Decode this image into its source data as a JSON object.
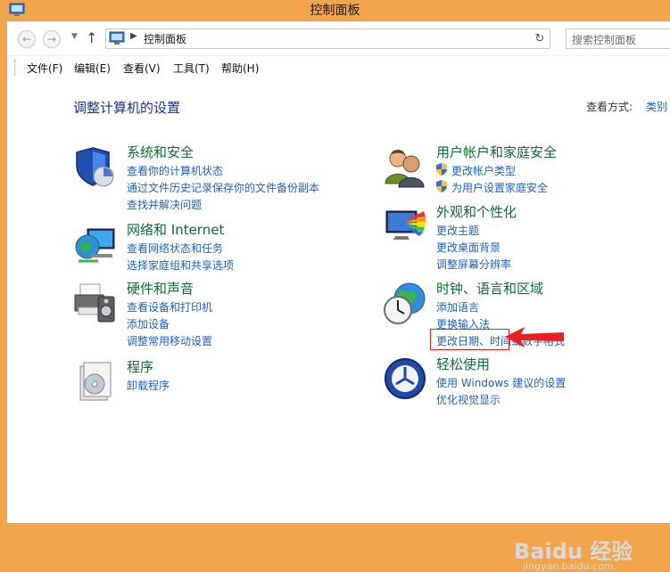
{
  "window": {
    "title": "控制面板"
  },
  "address": {
    "path": "控制面板",
    "search_placeholder": "搜索控制面板"
  },
  "menu": {
    "file": "文件(F)",
    "edit": "编辑(E)",
    "view": "查看(V)",
    "tools": "工具(T)",
    "help": "帮助(H)"
  },
  "main": {
    "heading": "调整计算机的设置",
    "view_by_label": "查看方式:",
    "view_by_value": "类别"
  },
  "categories": [
    {
      "title": "系统和安全",
      "links": [
        "查看你的计算机状态",
        "通过文件历史记录保存你的文件备份副本",
        "查找并解决问题"
      ]
    },
    {
      "title": "网络和 Internet",
      "links": [
        "查看网络状态和任务",
        "选择家庭组和共享选项"
      ]
    },
    {
      "title": "硬件和声音",
      "links": [
        "查看设备和打印机",
        "添加设备",
        "调整常用移动设置"
      ]
    },
    {
      "title": "程序",
      "links": [
        "卸载程序"
      ]
    },
    {
      "title": "用户帐户和家庭安全",
      "links": [
        "更改帐户类型",
        "为用户设置家庭安全"
      ]
    },
    {
      "title": "外观和个性化",
      "links": [
        "更改主题",
        "更改桌面背景",
        "调整屏幕分辨率"
      ]
    },
    {
      "title": "时钟、语言和区域",
      "links": [
        "添加语言",
        "更换输入法",
        "更改日期、时间或数字格式"
      ]
    },
    {
      "title": "轻松使用",
      "links": [
        "使用 Windows 建议的设置",
        "优化视觉显示"
      ]
    }
  ],
  "watermark": {
    "brand": "Baidu 经验",
    "url": "jingyan.baidu.com"
  },
  "colors": {
    "window_frame": "#f2a54a",
    "link": "#1e60c8",
    "category_title": "#0c6e2e",
    "heading": "#1e3287",
    "annotation": "#e82020"
  }
}
